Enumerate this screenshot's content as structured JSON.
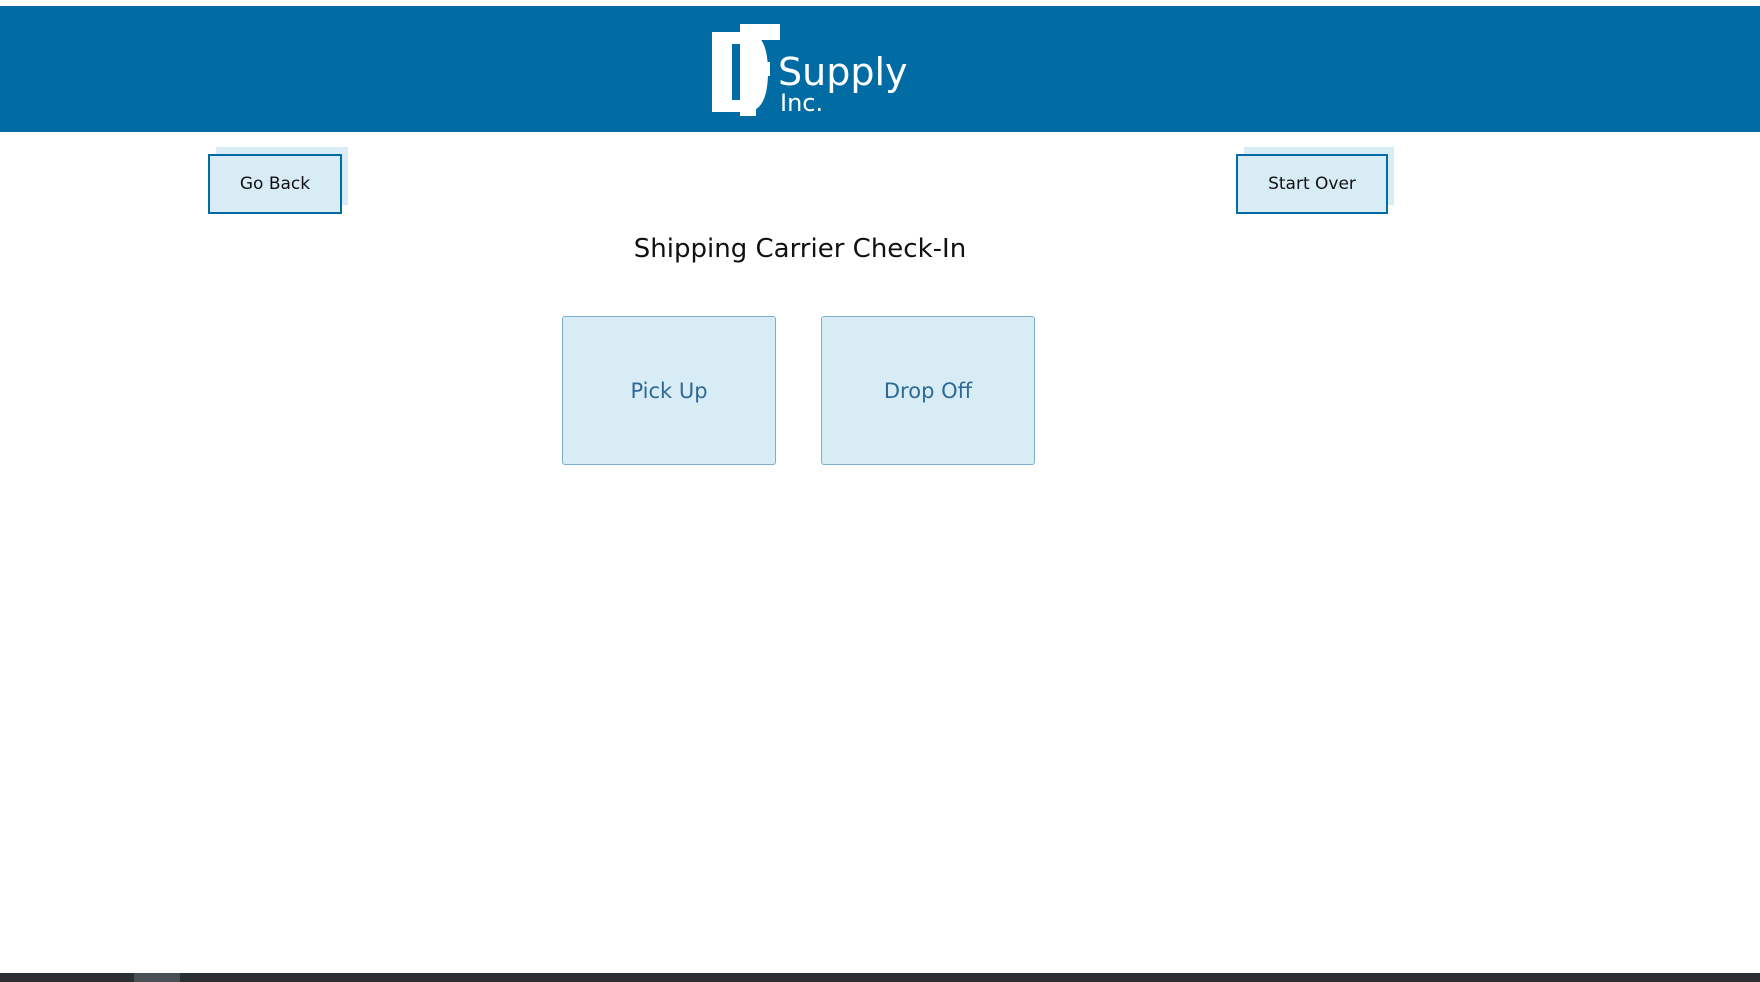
{
  "header": {
    "logo_mark": "DF",
    "logo_text_line1": "Supply",
    "logo_text_line2": "Inc.",
    "background_color": "#006ca3"
  },
  "nav": {
    "go_back_label": "Go Back",
    "start_over_label": "Start Over"
  },
  "main": {
    "title": "Shipping Carrier Check-In",
    "options": [
      {
        "label": "Pick Up"
      },
      {
        "label": "Drop Off"
      }
    ]
  },
  "colors": {
    "accent": "#006ca3",
    "tile_background": "#d8ecf6",
    "tile_text": "#2f6a94"
  }
}
